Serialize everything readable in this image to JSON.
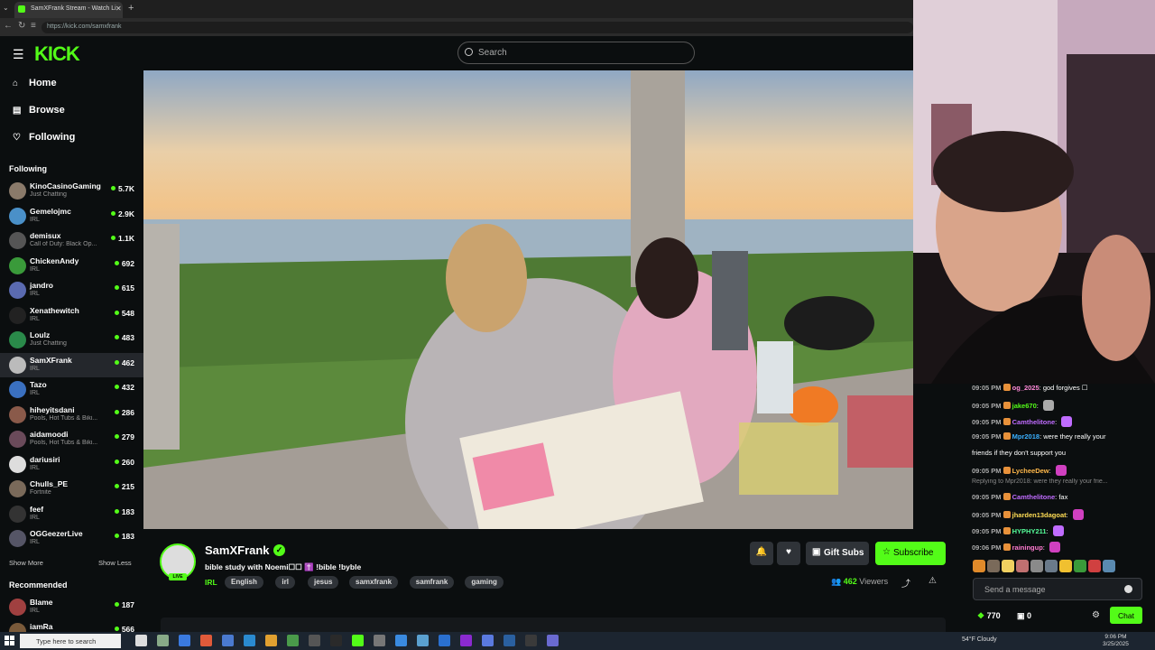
{
  "browser": {
    "tab_title": "SamXFrank Stream - Watch Li",
    "url": "https://kick.com/samxfrank"
  },
  "header": {
    "logo": "KICK",
    "search_placeholder": "Search"
  },
  "nav": {
    "home": "Home",
    "browse": "Browse",
    "following": "Following"
  },
  "sidebar": {
    "following_heading": "Following",
    "following": [
      {
        "name": "KinoCasinoGaming",
        "category": "Just Chatting",
        "viewers": "5.7K",
        "avatar": "#8a7a6a"
      },
      {
        "name": "Gemelojmc",
        "category": "IRL",
        "viewers": "2.9K",
        "avatar": "#4a90c8"
      },
      {
        "name": "demisux",
        "category": "Call of Duty: Black Op...",
        "viewers": "1.1K",
        "avatar": "#555"
      },
      {
        "name": "ChickenAndy",
        "category": "IRL",
        "viewers": "692",
        "avatar": "#3a9a3a"
      },
      {
        "name": "jandro",
        "category": "IRL",
        "viewers": "615",
        "avatar": "#5a6ab0"
      },
      {
        "name": "Xenathewitch",
        "category": "IRL",
        "viewers": "548",
        "avatar": "#222"
      },
      {
        "name": "Loulz",
        "category": "Just Chatting",
        "viewers": "483",
        "avatar": "#2a8a4a"
      },
      {
        "name": "SamXFrank",
        "category": "IRL",
        "viewers": "462",
        "avatar": "#bbb"
      },
      {
        "name": "Tazo",
        "category": "IRL",
        "viewers": "432",
        "avatar": "#3a70c0"
      },
      {
        "name": "hiheyitsdani",
        "category": "Pools, Hot Tubs & Biki...",
        "viewers": "286",
        "avatar": "#8a5a4a"
      },
      {
        "name": "aidamoodi",
        "category": "Pools, Hot Tubs & Biki...",
        "viewers": "279",
        "avatar": "#6a4a5a"
      },
      {
        "name": "dariusiri",
        "category": "IRL",
        "viewers": "260",
        "avatar": "#ddd"
      },
      {
        "name": "Chulls_PE",
        "category": "Fortnite",
        "viewers": "215",
        "avatar": "#7a6a5a"
      },
      {
        "name": "feef",
        "category": "IRL",
        "viewers": "183",
        "avatar": "#333"
      },
      {
        "name": "OGGeezerLive",
        "category": "IRL",
        "viewers": "183",
        "avatar": "#556"
      }
    ],
    "show_more": "Show More",
    "show_less": "Show Less",
    "recommended_heading": "Recommended",
    "recommended": [
      {
        "name": "Blame",
        "category": "IRL",
        "viewers": "187",
        "avatar": "#a04040"
      },
      {
        "name": "iamRa",
        "category": "",
        "viewers": "566",
        "avatar": "#7a5a3a"
      }
    ]
  },
  "stream": {
    "streamer": "SamXFrank",
    "live_badge": "LIVE",
    "title": "bible study with Noemi☐☐ ✝️ !bible !byble",
    "category": "IRL",
    "tags": [
      "English",
      "irl",
      "jesus",
      "samxfrank",
      "samfrank",
      "gaming"
    ],
    "gift_subs": "Gift Subs",
    "subscribe": "Subscribe",
    "viewers_count": "462",
    "viewers_label": "Viewers"
  },
  "chat": {
    "messages": [
      {
        "time": "09:05 PM",
        "user": "og_2025",
        "user_color": "#ff8ad8",
        "text": " god forgives ☐",
        "emote": ""
      },
      {
        "time": "09:05 PM",
        "user": "jake670",
        "user_color": "#53fc18",
        "text": " ",
        "emote": "#aaa"
      },
      {
        "time": "09:05 PM",
        "user": "Camthelitone",
        "user_color": "#c06cff",
        "text": " ",
        "emote": "#c06cff"
      },
      {
        "time": "09:05 PM",
        "user": "Mpr2018",
        "user_color": "#3ab0ff",
        "text": " were they really your",
        "emote": ""
      },
      {
        "time": "",
        "user": "",
        "user_color": "#fff",
        "text": "friends if they don't support you",
        "emote": ""
      },
      {
        "time": "09:05 PM",
        "user": "LycheeDew",
        "user_color": "#ffb84a",
        "text": " ",
        "emote": "#d040c0"
      },
      {
        "time": "09:05 PM",
        "user": "Camthelitone",
        "user_color": "#c06cff",
        "text": " fax",
        "emote": ""
      },
      {
        "time": "09:05 PM",
        "user": "jharden13dagoat",
        "user_color": "#ffdd55",
        "text": " ",
        "emote": "#d040c0"
      },
      {
        "time": "09:05 PM",
        "user": "HYPHY211",
        "user_color": "#55ff9a",
        "text": " ",
        "emote": "#c06cff"
      },
      {
        "time": "09:06 PM",
        "user": "rainingup",
        "user_color": "#ff7ad0",
        "text": " ",
        "emote": "#d040c0"
      }
    ],
    "reply_line": "Replying to Mpr2018: were they really your frie...",
    "input_placeholder": "Send a message",
    "points": "770",
    "zero": "0",
    "chat_button": "Chat"
  },
  "taskbar": {
    "search_placeholder": "Type here to search",
    "weather": "54°F  Cloudy",
    "time": "9:06 PM",
    "date": "3/25/2025"
  }
}
